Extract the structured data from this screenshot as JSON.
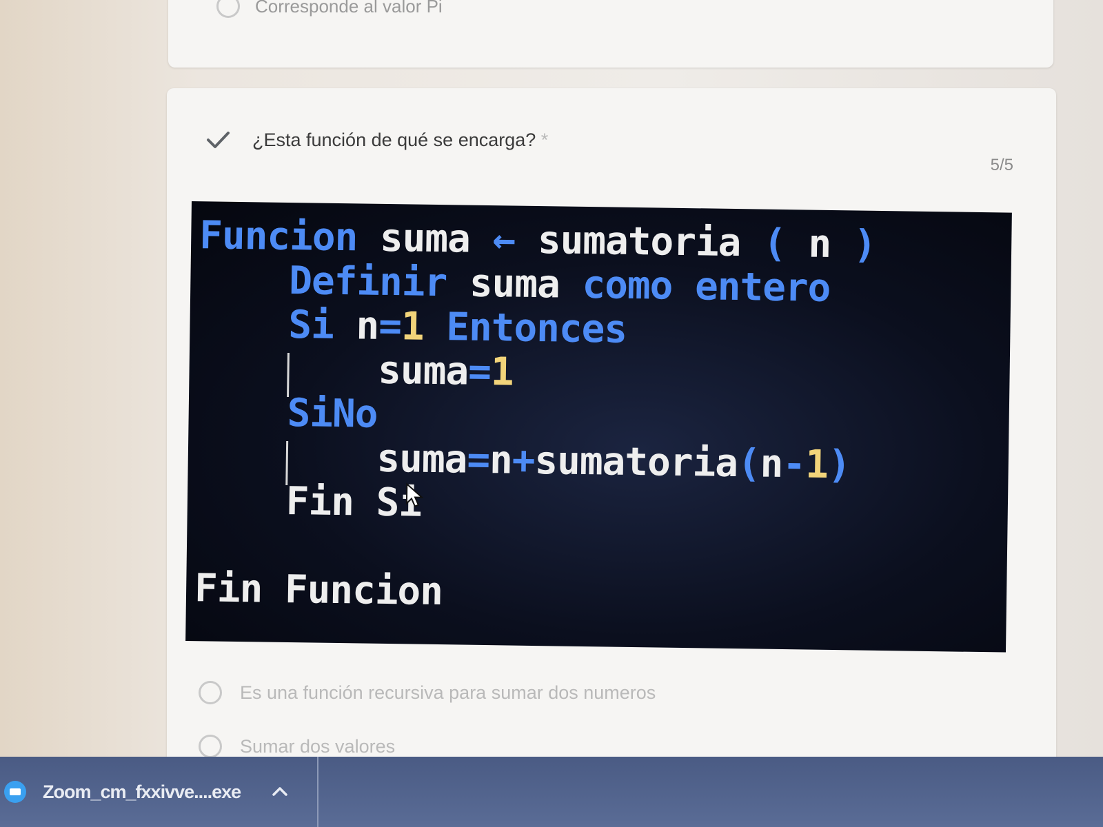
{
  "previous_question": {
    "option_text": "Corresponde al valor Pi"
  },
  "question": {
    "text": "¿Esta función de qué se encarga?",
    "required_marker": "*",
    "score": "5/5"
  },
  "code": {
    "lines": [
      {
        "tokens": [
          {
            "t": "Funcion ",
            "c": "kw"
          },
          {
            "t": "suma ",
            "c": "id"
          },
          {
            "t": "← ",
            "c": "op"
          },
          {
            "t": "sumatoria ",
            "c": "id"
          },
          {
            "t": "( ",
            "c": "op"
          },
          {
            "t": "n ",
            "c": "id"
          },
          {
            "t": ")",
            "c": "op"
          }
        ]
      },
      {
        "tokens": [
          {
            "t": "    ",
            "c": "id"
          },
          {
            "t": "Definir ",
            "c": "kw"
          },
          {
            "t": "suma ",
            "c": "id"
          },
          {
            "t": "como entero",
            "c": "kw"
          }
        ]
      },
      {
        "tokens": [
          {
            "t": "    ",
            "c": "id"
          },
          {
            "t": "Si ",
            "c": "kw"
          },
          {
            "t": "n",
            "c": "id"
          },
          {
            "t": "=",
            "c": "op"
          },
          {
            "t": "1 ",
            "c": "num"
          },
          {
            "t": "Entonces",
            "c": "kw"
          }
        ]
      },
      {
        "tokens": [
          {
            "t": "        ",
            "c": "id"
          },
          {
            "t": "suma",
            "c": "id"
          },
          {
            "t": "=",
            "c": "op"
          },
          {
            "t": "1",
            "c": "num"
          }
        ]
      },
      {
        "tokens": [
          {
            "t": "    ",
            "c": "id"
          },
          {
            "t": "SiNo",
            "c": "kw"
          }
        ]
      },
      {
        "tokens": [
          {
            "t": "        ",
            "c": "id"
          },
          {
            "t": "suma",
            "c": "id"
          },
          {
            "t": "=",
            "c": "op"
          },
          {
            "t": "n",
            "c": "id"
          },
          {
            "t": "+",
            "c": "op"
          },
          {
            "t": "sumatoria",
            "c": "id"
          },
          {
            "t": "(",
            "c": "op"
          },
          {
            "t": "n",
            "c": "id"
          },
          {
            "t": "-",
            "c": "op"
          },
          {
            "t": "1",
            "c": "num"
          },
          {
            "t": ")",
            "c": "op"
          }
        ]
      },
      {
        "tokens": [
          {
            "t": "    ",
            "c": "id"
          },
          {
            "t": "Fin Si",
            "c": "id"
          }
        ]
      },
      {
        "tokens": [
          {
            "t": "",
            "c": "id"
          }
        ]
      },
      {
        "tokens": [
          {
            "t": "Fin Funcion",
            "c": "id"
          }
        ]
      }
    ]
  },
  "options": [
    {
      "label": "Es una función recursiva para sumar dos numeros"
    },
    {
      "label": "Sumar dos valores"
    }
  ],
  "taskbar": {
    "download_name": "Zoom_cm_fxxivve....exe"
  },
  "colors": {
    "keyword": "#4d8bf5",
    "identifier": "#eeeeee",
    "number": "#f2d47a",
    "check": "#5f6368",
    "taskbar": "#4a5b84"
  },
  "icons": {
    "check": "check-icon",
    "cursor": "mouse-pointer-icon",
    "zoom": "zoom-icon",
    "chevron": "chevron-up-icon"
  }
}
